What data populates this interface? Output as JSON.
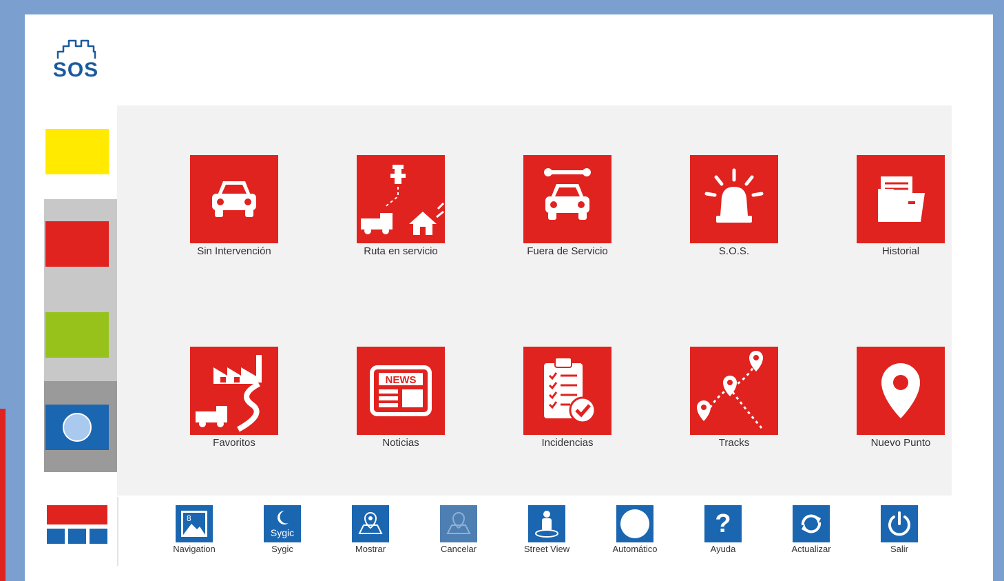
{
  "logo": {
    "text": "SOS"
  },
  "status_swatches": [
    {
      "name": "yellow",
      "color": "#ffea00"
    },
    {
      "name": "red",
      "color": "#e0231f"
    },
    {
      "name": "green",
      "color": "#97c21c"
    },
    {
      "name": "blue",
      "color": "#1b66b0"
    }
  ],
  "colors": {
    "accent_red": "#e0231f",
    "toolbar_blue": "#1b66b0",
    "panel_gray": "#f2f2f2"
  },
  "tiles": [
    {
      "label": "Sin Intervención",
      "icon": "car-icon"
    },
    {
      "label": "Ruta en servicio",
      "icon": "fire-route-icon"
    },
    {
      "label": "Fuera de Servicio",
      "icon": "car-wrench-icon"
    },
    {
      "label": "S.O.S.",
      "icon": "siren-icon"
    },
    {
      "label": "Historial",
      "icon": "folder-icon"
    },
    {
      "label": "Favoritos",
      "icon": "factory-icon"
    },
    {
      "label": "Noticias",
      "icon": "newspaper-icon"
    },
    {
      "label": "Incidencias",
      "icon": "clipboard-check-icon"
    },
    {
      "label": "Tracks",
      "icon": "map-pins-icon"
    },
    {
      "label": "Nuevo Punto",
      "icon": "location-pin-icon"
    }
  ],
  "toolbar": [
    {
      "label": "Navigation",
      "icon": "navigation-map-icon"
    },
    {
      "label": "Sygic",
      "icon": "sygic-icon",
      "icon_text": "Sygic"
    },
    {
      "label": "Mostrar",
      "icon": "show-map-icon"
    },
    {
      "label": "Cancelar",
      "icon": "cancel-map-icon"
    },
    {
      "label": "Street View",
      "icon": "street-view-icon"
    },
    {
      "label": "Automático",
      "icon": "circle-icon"
    },
    {
      "label": "Ayuda",
      "icon": "help-icon",
      "icon_text": "?"
    },
    {
      "label": "Actualizar",
      "icon": "refresh-icon"
    },
    {
      "label": "Salir",
      "icon": "power-icon"
    }
  ]
}
